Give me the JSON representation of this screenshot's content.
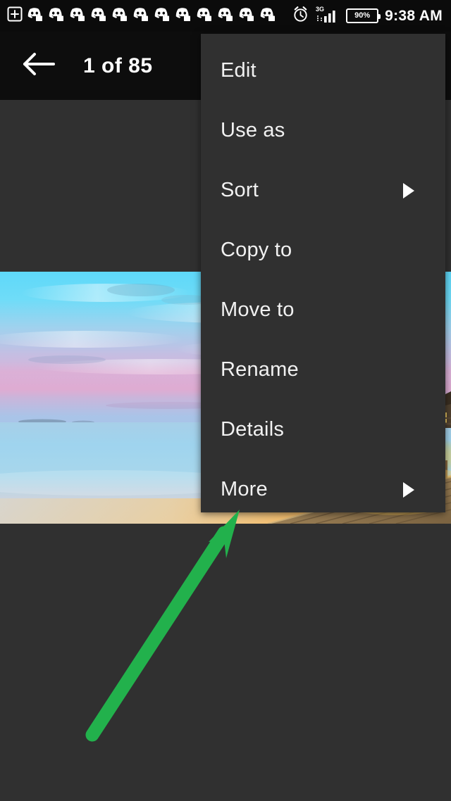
{
  "status_bar": {
    "notification_icons": [
      {
        "name": "add-to-screen-icon",
        "label": "Add"
      },
      {
        "name": "discord-notification-icon",
        "label": "Discord"
      },
      {
        "name": "discord-notification-icon",
        "label": "Discord"
      },
      {
        "name": "discord-notification-icon",
        "label": "Discord"
      },
      {
        "name": "discord-notification-icon",
        "label": "Discord"
      },
      {
        "name": "discord-notification-icon",
        "label": "Discord"
      },
      {
        "name": "discord-notification-icon",
        "label": "Discord"
      },
      {
        "name": "discord-notification-icon",
        "label": "Discord"
      },
      {
        "name": "discord-notification-icon",
        "label": "Discord"
      },
      {
        "name": "discord-notification-icon",
        "label": "Discord"
      },
      {
        "name": "discord-notification-icon",
        "label": "Discord"
      },
      {
        "name": "discord-notification-icon",
        "label": "Discord"
      },
      {
        "name": "discord-notification-icon",
        "label": "Discord"
      }
    ],
    "alarm_icon": "alarm-clock-icon",
    "network_type": "3G",
    "signal_icon": "signal-bars-icon",
    "battery_percent": "90%",
    "clock": "9:38 AM"
  },
  "toolbar": {
    "back_icon": "back-arrow-icon",
    "title": "1 of 85"
  },
  "photo": {
    "alt": "Tropical beach sunset with overwater bungalows and wooden pier"
  },
  "menu": {
    "items": [
      {
        "label": "Edit",
        "has_submenu": false
      },
      {
        "label": "Use as",
        "has_submenu": false
      },
      {
        "label": "Sort",
        "has_submenu": true
      },
      {
        "label": "Copy to",
        "has_submenu": false
      },
      {
        "label": "Move to",
        "has_submenu": false
      },
      {
        "label": "Rename",
        "has_submenu": false
      },
      {
        "label": "Details",
        "has_submenu": false
      },
      {
        "label": "More",
        "has_submenu": true
      }
    ]
  },
  "annotation": {
    "arrow_color": "#22b14c",
    "points_to": "More"
  },
  "colors": {
    "background": "#303030",
    "toolbar": "#0d0d0d",
    "status_bar": "#0b0b0b",
    "menu_background": "#303030",
    "text": "#f1f1f1",
    "accent_green": "#22b14c"
  }
}
